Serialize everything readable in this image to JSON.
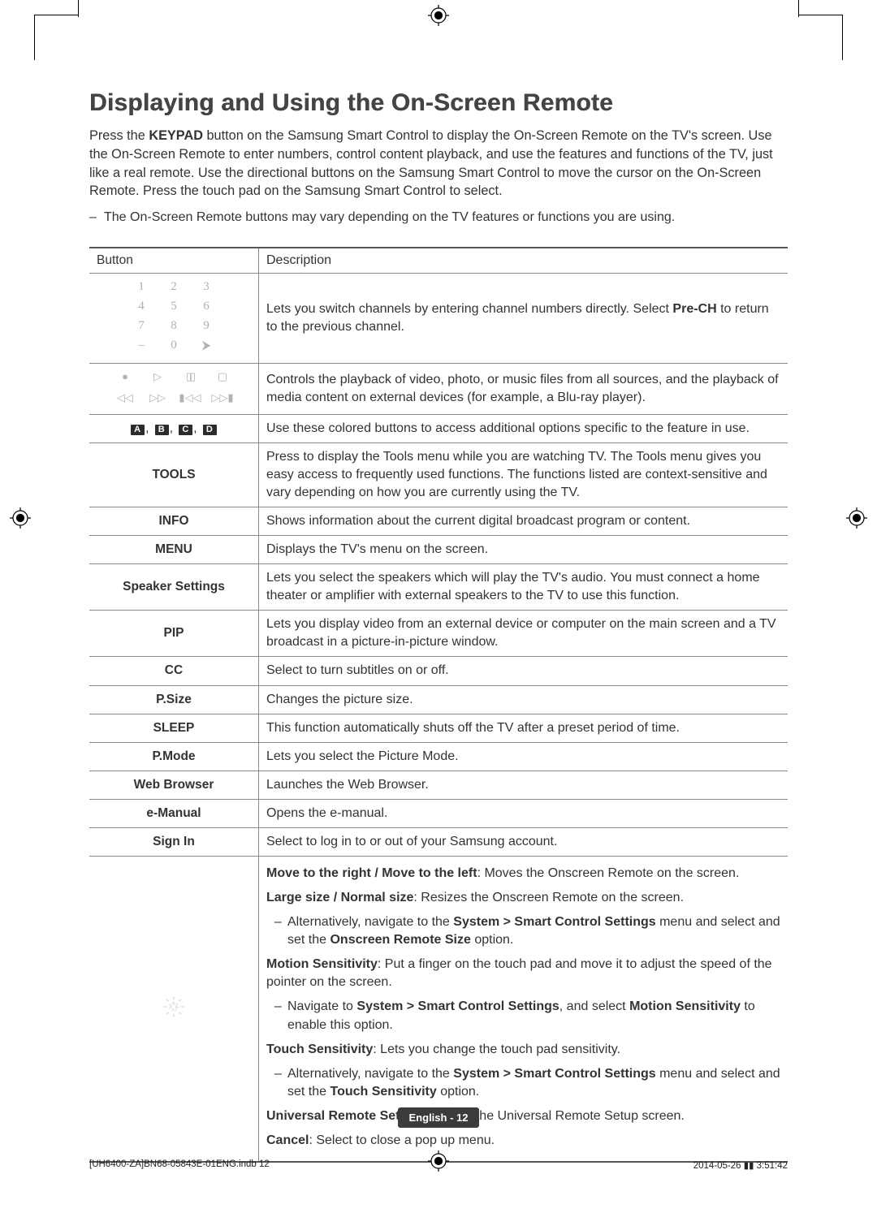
{
  "page": {
    "heading": "Displaying and Using the On-Screen Remote",
    "intro_pre": "Press the ",
    "intro_key": "KEYPAD",
    "intro_post": " button on the Samsung Smart Control to display the On-Screen Remote on the TV's screen. Use the On-Screen Remote to enter numbers, control content playback, and use the features and functions of the TV, just like a real remote. Use the directional buttons on the Samsung Smart Control to move the cursor on the On-Screen Remote. Press the touch pad on the Samsung Smart Control to select.",
    "note": "The On-Screen Remote buttons may vary depending on the TV features or functions you are using.",
    "table": {
      "header_button": "Button",
      "header_desc": "Description"
    },
    "rows": {
      "keypad": {
        "keys": [
          "1",
          "2",
          "3",
          "4",
          "5",
          "6",
          "7",
          "8",
          "9",
          "–",
          "0",
          "⮞"
        ],
        "desc_pre": "Lets you switch channels by entering channel numbers directly. Select ",
        "desc_b": "Pre-CH",
        "desc_post": " to return to the previous channel."
      },
      "playback": {
        "desc": "Controls the playback of video, photo, or music files from all sources, and the playback of media content on external devices (for example, a Blu-ray player)."
      },
      "color": {
        "labels": [
          "A",
          "B",
          "C",
          "D"
        ],
        "desc": "Use these colored buttons to access additional options specific to the feature in use."
      },
      "tools": {
        "label": "TOOLS",
        "desc": "Press to display the Tools menu while you are watching TV. The Tools menu gives you easy access to frequently used functions. The functions listed are context-sensitive and vary depending on how you are currently using the TV."
      },
      "info": {
        "label": "INFO",
        "desc": "Shows information about the current digital broadcast program or content."
      },
      "menu": {
        "label": "MENU",
        "desc": "Displays the TV's menu on the screen."
      },
      "speaker": {
        "label": "Speaker Settings",
        "desc": "Lets you select the speakers which will play the TV's audio. You must connect a home theater or amplifier with external speakers to the TV to use this function."
      },
      "pip": {
        "label": "PIP",
        "desc": "Lets you display video from an external device or computer on the main screen and a TV broadcast in a picture-in-picture window."
      },
      "cc": {
        "label": "CC",
        "desc": "Select to turn subtitles on or off."
      },
      "psize": {
        "label": "P.Size",
        "desc": "Changes the picture size."
      },
      "sleep": {
        "label": "SLEEP",
        "desc": "This function automatically shuts off the TV after a preset period of time."
      },
      "pmode": {
        "label": "P.Mode",
        "desc": "Lets you select the Picture Mode."
      },
      "web": {
        "label": "Web Browser",
        "desc": "Launches the Web Browser."
      },
      "emanual": {
        "label": "e-Manual",
        "desc": "Opens the e-manual."
      },
      "signin": {
        "label": "Sign In",
        "desc": "Select to log in to or out of your Samsung account."
      },
      "gear": {
        "l1_b": "Move to the right / Move to the left",
        "l1_t": ": Moves the Onscreen Remote on the screen.",
        "l2_b": "Large size / Normal size",
        "l2_t": ": Resizes the Onscreen Remote on the screen.",
        "l2_sub_a": "Alternatively, navigate to the ",
        "l2_sub_b": "System > Smart Control Settings",
        "l2_sub_c": " menu and select and set the ",
        "l2_sub_d": "Onscreen Remote Size",
        "l2_sub_e": " option.",
        "l3_b": "Motion Sensitivity",
        "l3_t": ": Put a finger on the touch pad and move it to adjust the speed of the pointer on the screen.",
        "l3_sub_a": "Navigate to ",
        "l3_sub_b": "System > Smart Control Settings",
        "l3_sub_c": ", and select ",
        "l3_sub_d": "Motion Sensitivity",
        "l3_sub_e": " to enable this option.",
        "l4_b": "Touch Sensitivity",
        "l4_t": ": Lets you change the touch pad sensitivity.",
        "l4_sub_a": "Alternatively, navigate to the ",
        "l4_sub_b": "System > Smart Control Settings",
        "l4_sub_c": " menu and select and set the ",
        "l4_sub_d": "Touch Sensitivity",
        "l4_sub_e": " option.",
        "l5_b": "Universal Remote Setup",
        "l5_t": ": Displays the Universal Remote Setup screen.",
        "l6_b": "Cancel",
        "l6_t": ": Select to close a pop up menu."
      }
    },
    "footer": {
      "lang_page": "English - 12",
      "docname": "[UH6400-ZA]BN68-05843E-01ENG.indb   12",
      "timestamp": "2014-05-26   ▮▮ 3:51:42"
    }
  }
}
